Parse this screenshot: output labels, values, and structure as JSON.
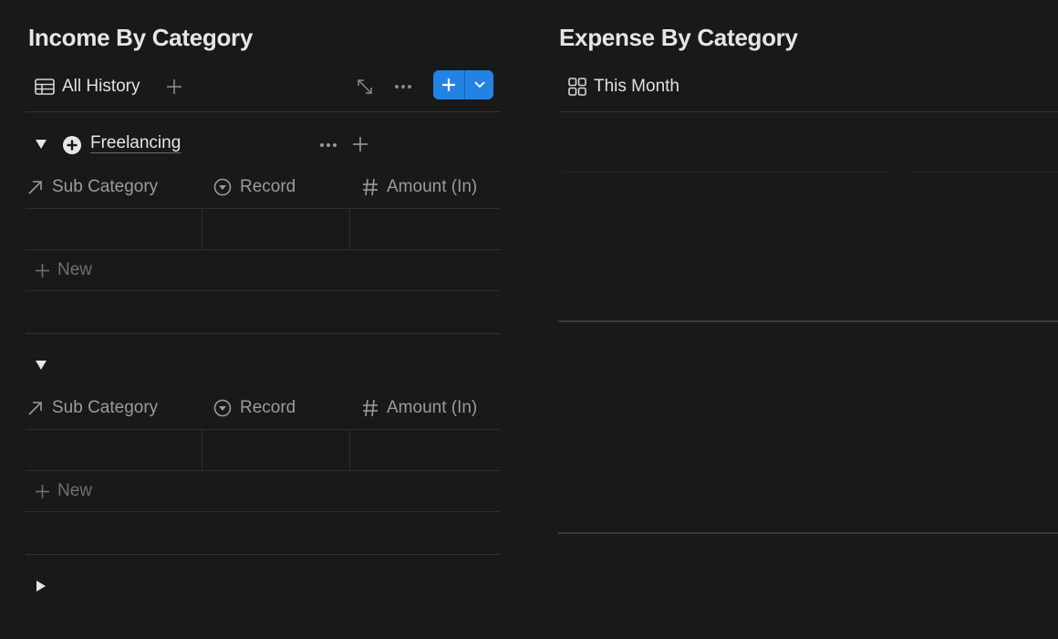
{
  "income": {
    "title": "Income By Category",
    "view": {
      "label": "All History",
      "icon": "table-icon"
    },
    "toolbar": {
      "add_view_icon": "plus-icon",
      "expand_icon": "expand-icon",
      "more_icon": "more-dots-icon",
      "new_button_icon": "plus-icon",
      "new_dropdown_icon": "chevron-down-icon"
    },
    "columns": [
      {
        "label": "Sub Category",
        "icon": "relation-arrow-icon"
      },
      {
        "label": "Record",
        "icon": "status-select-icon"
      },
      {
        "label": "Amount (In)",
        "icon": "number-hash-icon"
      }
    ],
    "groups": [
      {
        "name": "Freelancing",
        "expanded": true,
        "new_label": "New"
      },
      {
        "name": "",
        "expanded": true,
        "new_label": "New"
      },
      {
        "name": "",
        "expanded": false
      }
    ]
  },
  "expense": {
    "title": "Expense By Category",
    "view": {
      "label": "This Month",
      "icon": "gallery-icon"
    }
  },
  "colors": {
    "background": "#191919",
    "accent": "#2383e2",
    "text": "#e6e6e6",
    "muted": "#9b9b9b"
  }
}
